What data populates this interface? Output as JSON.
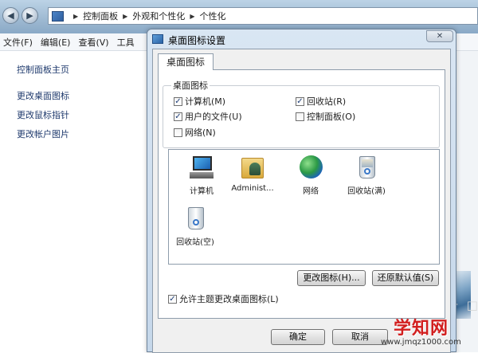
{
  "explorer": {
    "address": {
      "segments": [
        "控制面板",
        "外观和个性化",
        "个性化"
      ]
    },
    "menu": [
      "文件(F)",
      "编辑(E)",
      "查看(V)",
      "工具"
    ],
    "left_links": {
      "home": "控制面板主页",
      "desktop_icons": "更改桌面图标",
      "mouse_pointers": "更改鼠标指针",
      "account_picture": "更改帐户图片"
    }
  },
  "dialog": {
    "title": "桌面图标设置",
    "close_glyph": "✕",
    "tab_label": "桌面图标",
    "group_label": "桌面图标",
    "checkboxes": {
      "computer": {
        "label": "计算机(M)",
        "checked": true
      },
      "recycle_bin": {
        "label": "回收站(R)",
        "checked": true
      },
      "user_files": {
        "label": "用户的文件(U)",
        "checked": true
      },
      "control_panel": {
        "label": "控制面板(O)",
        "checked": false
      },
      "network": {
        "label": "网络(N)",
        "checked": false
      }
    },
    "icons": [
      {
        "label": "计算机",
        "icon": "computer-icon"
      },
      {
        "label": "Administ...",
        "icon": "user-folder-icon"
      },
      {
        "label": "网络",
        "icon": "network-icon"
      },
      {
        "label": "回收站(满)",
        "icon": "recycle-bin-full-icon"
      },
      {
        "label": "回收站(空)",
        "icon": "recycle-bin-empty-icon"
      }
    ],
    "change_icon_button": "更改图标(H)...",
    "restore_default_button": "还原默认值(S)",
    "theme_checkbox": {
      "label": "允许主题更改桌面图标(L)",
      "checked": true
    },
    "ok_button": "确定",
    "cancel_button": "取消"
  },
  "watermark": {
    "site_name": "学知网",
    "url": "www.jmqz1000.com"
  }
}
